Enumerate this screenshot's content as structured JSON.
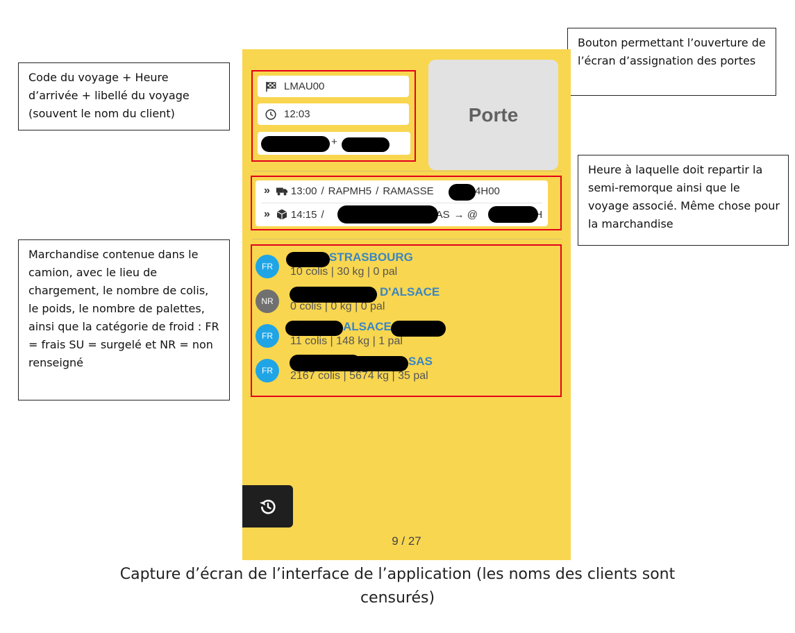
{
  "annotations": {
    "trip_info": "Code du voyage + Heure d’arrivée + libellé du voyage (souvent le nom du client)",
    "door_button": "Bouton permettant l’ouverture de l’écran d’assignation des portes",
    "departure": "Heure à laquelle doit repartir la semi-remorque ainsi que le voyage associé. Même chose pour la marchandise",
    "goods": "Marchandise contenue dans le camion, avec le lieu de chargement, le nombre de colis, le poids, le nombre de palettes, ainsi que la catégorie de froid : FR = frais SU = surgelé et NR = non renseigné"
  },
  "caption": {
    "line1": "Capture d’écran de l’interface de l’application (les noms des clients sont",
    "line2": "censurés)"
  },
  "trip": {
    "code": "LMAU00",
    "code_icon": "checkered-flag-icon",
    "arrival_time": "12:03",
    "time_icon": "clock-icon",
    "label_visible": "+"
  },
  "door_button_label": "Porte",
  "departures": [
    {
      "icon": "truck-icon",
      "time": "13:00",
      "sep1": "/",
      "code": "RAPMH5",
      "sep2": "/",
      "label_start": "RAMASSE",
      "label_end": "H 14H00"
    },
    {
      "icon": "box-icon",
      "time": "14:15",
      "sep1": "/",
      "label_mid": "SAS",
      "arrow": "→ @",
      "label_end": "2H"
    }
  ],
  "goods": [
    {
      "category": "FR",
      "name_visible": "STRASBOURG",
      "stats": "10 colis | 30 kg | 0 pal"
    },
    {
      "category": "NR",
      "name_visible": "D'ALSACE",
      "stats": "0 colis | 0 kg | 0 pal"
    },
    {
      "category": "FR",
      "name_visible": "ALSACE",
      "stats": "11 colis | 148 kg | 1 pal"
    },
    {
      "category": "FR",
      "name_visible": "SAS",
      "stats": "2167 colis | 5674 kg | 35 pal"
    }
  ],
  "pager": "9 / 27",
  "colors": {
    "app_background": "#f8d64f",
    "highlight": "#e3001b",
    "category_fr": "#1fa5e6",
    "category_nr": "#707070",
    "goods_name": "#3a86c4",
    "history_button": "#1f1f1f"
  }
}
